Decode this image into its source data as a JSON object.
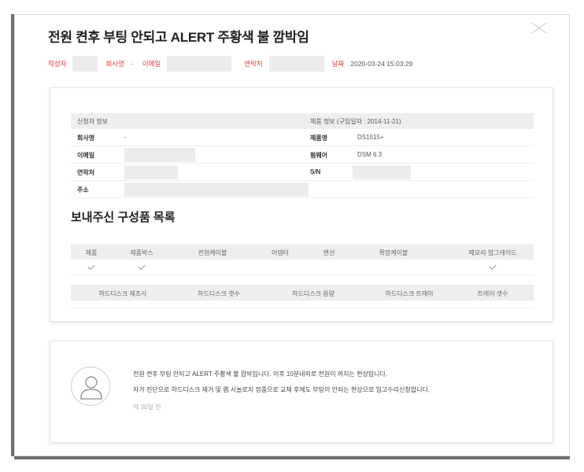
{
  "title": "전원 켠후 부팅 안되고 ALERT 주황색 불 깜박임",
  "meta": {
    "author_label": "작성자",
    "company_label": "회사명",
    "company_value": "-",
    "email_label": "이메일",
    "contact_label": "연락처",
    "date_label": "날짜",
    "date_value": "2020-03-24 15:03:29"
  },
  "applicant": {
    "header": "신청자 정보",
    "rows": [
      {
        "label": "회사명",
        "value": "-"
      },
      {
        "label": "이메일",
        "value": ""
      },
      {
        "label": "연락처",
        "value": ""
      },
      {
        "label": "주소",
        "value": ""
      }
    ]
  },
  "product": {
    "header": "제품 정보 (구입일자 : 2014-11-21)",
    "rows": [
      {
        "label": "제품명",
        "value": "DS1515+"
      },
      {
        "label": "펌웨어",
        "value": "DSM 6.3"
      },
      {
        "label": "S/N",
        "value": ""
      }
    ]
  },
  "components": {
    "title": "보내주신 구성품 목록",
    "columns": [
      "제품",
      "제품박스",
      "전원케이블",
      "어댑터",
      "랜선",
      "확장케이블",
      "메모리 업그레이드"
    ],
    "checked": [
      true,
      true,
      false,
      false,
      false,
      false,
      true
    ]
  },
  "hdd": {
    "columns": [
      "하드디스크 제조사",
      "하드디스크 갯수",
      "하드디스크 용량",
      "하드디스크 트레이",
      "트레이 갯수"
    ]
  },
  "comment": {
    "line1": "전원 켠후 부팅 안되고 ALERT 주황색 불 깜박입니다. 이후 10분내외로 전원이 꺼지는 현상입니다.",
    "line2": "자가 진단으로 하드디스크 제거 및 램 시놀로지 정품으로 교체 후에도 부팅이 안되는 현상으로 입고수리신청합니다.",
    "time": "약 30일 전"
  }
}
